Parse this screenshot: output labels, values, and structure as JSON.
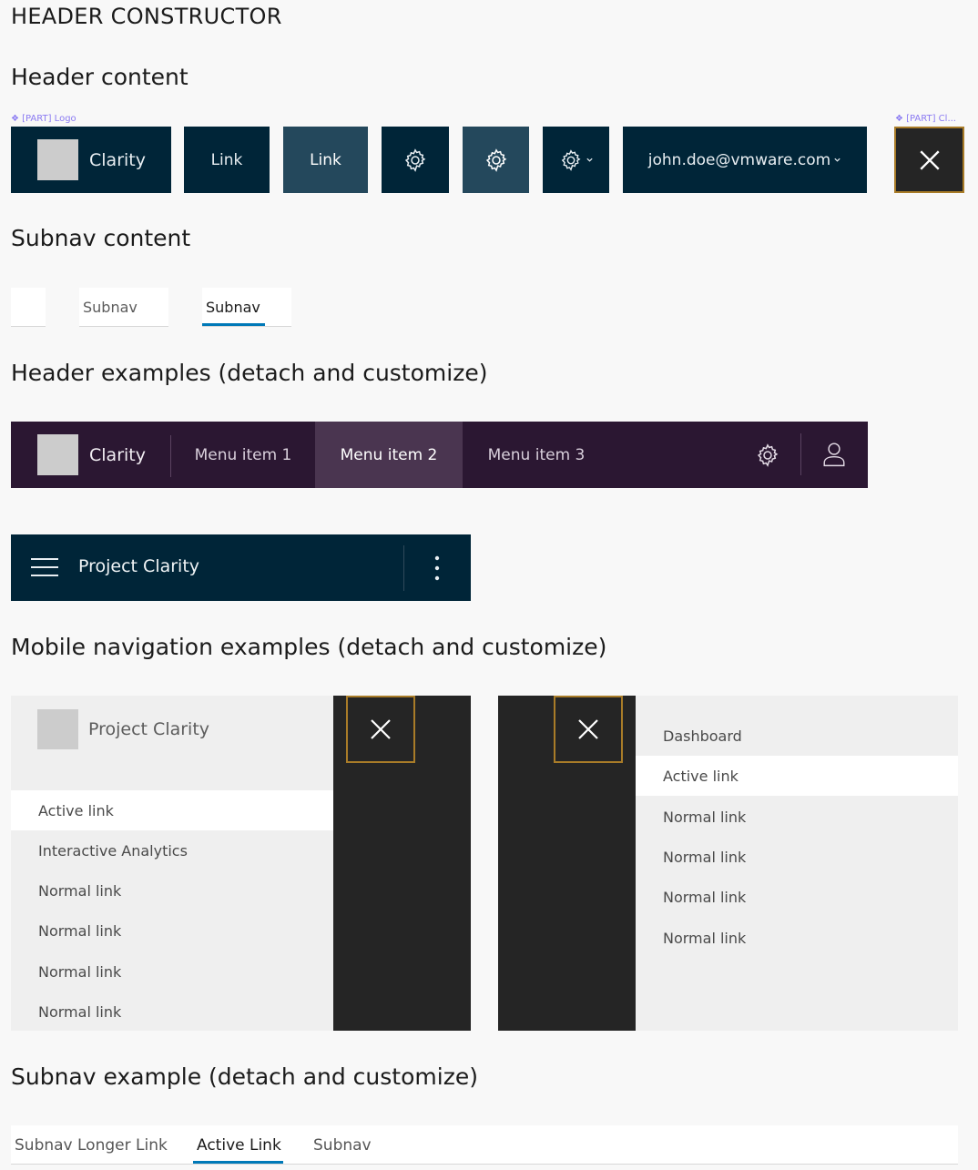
{
  "page_title": "HEADER CONSTRUCTOR",
  "sections": {
    "header_content": "Header content",
    "subnav_content": "Subnav content",
    "header_examples": "Header examples (detach and customize)",
    "mobile_examples": "Mobile navigation examples (detach and customize)",
    "subnav_example": "Subnav example (detach and customize)"
  },
  "part_labels": {
    "logo": "❖ [PART] Logo",
    "close": "❖ [PART] Cl..."
  },
  "header_content": {
    "logo_text": "Clarity",
    "link_label": "Link",
    "link_active_label": "Link",
    "user_email": "john.doe@vmware.com"
  },
  "subnav_content": {
    "item_label": "Subnav",
    "active_label": "Subnav"
  },
  "header_example_1": {
    "logo_text": "Clarity",
    "menu_items": [
      "Menu item 1",
      "Menu item 2",
      "Menu item 3"
    ]
  },
  "header_example_2": {
    "title": "Project Clarity"
  },
  "mobile_1": {
    "title": "Project Clarity",
    "links": [
      "Active link",
      "Interactive Analytics",
      "Normal link",
      "Normal link",
      "Normal link",
      "Normal link"
    ]
  },
  "mobile_2": {
    "links": [
      "Dashboard",
      "Active link",
      "Normal link",
      "Normal link",
      "Normal link",
      "Normal link"
    ]
  },
  "subnav_example": {
    "tabs": [
      "Subnav Longer Link",
      "Active Link",
      "Subnav"
    ]
  },
  "colors": {
    "header_dark": "#002538",
    "header_active": "#24485c",
    "header_purple": "#2b1732",
    "purple_active": "#4a3550",
    "close_dark": "#252525",
    "close_border": "#a97c28",
    "subnav_active_underline": "#0079b8",
    "part_label": "#8b7bf2"
  }
}
